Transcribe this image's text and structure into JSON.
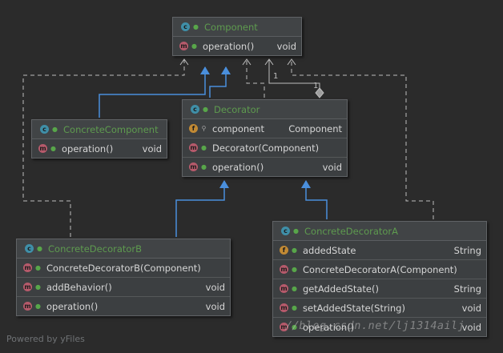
{
  "classes": {
    "component": {
      "name": "Component",
      "members": [
        {
          "kind": "m",
          "name": "operation()",
          "type": "void"
        }
      ]
    },
    "decorator": {
      "name": "Decorator",
      "members": [
        {
          "kind": "f",
          "name": "component",
          "type": "Component"
        },
        {
          "kind": "m",
          "name": "Decorator(Component)",
          "type": ""
        },
        {
          "kind": "m",
          "name": "operation()",
          "type": "void"
        }
      ]
    },
    "concrete_component": {
      "name": "ConcreteComponent",
      "members": [
        {
          "kind": "m",
          "name": "operation()",
          "type": "void"
        }
      ]
    },
    "concrete_decorator_b": {
      "name": "ConcreteDecoratorB",
      "members": [
        {
          "kind": "m",
          "name": "ConcreteDecoratorB(Component)",
          "type": ""
        },
        {
          "kind": "m",
          "name": "addBehavior()",
          "type": "void"
        },
        {
          "kind": "m",
          "name": "operation()",
          "type": "void"
        }
      ]
    },
    "concrete_decorator_a": {
      "name": "ConcreteDecoratorA",
      "members": [
        {
          "kind": "f",
          "name": "addedState",
          "type": "String"
        },
        {
          "kind": "m",
          "name": "ConcreteDecoratorA(Component)",
          "type": ""
        },
        {
          "kind": "m",
          "name": "getAddedState()",
          "type": "String"
        },
        {
          "kind": "m",
          "name": "setAddedState(String)",
          "type": "void"
        },
        {
          "kind": "m",
          "name": "operation()",
          "type": "void"
        }
      ]
    }
  },
  "aggregation_multiplicity_left": "1",
  "aggregation_multiplicity_right": "1",
  "footer": "Powered by yFiles",
  "watermark": "//blog.csdn.net/lj1314ailj",
  "colors": {
    "background": "#2b2b2b",
    "class_title": "#5e9b4f",
    "inheritance": "#4a8fdc",
    "dependency": "#bdbdbd"
  }
}
